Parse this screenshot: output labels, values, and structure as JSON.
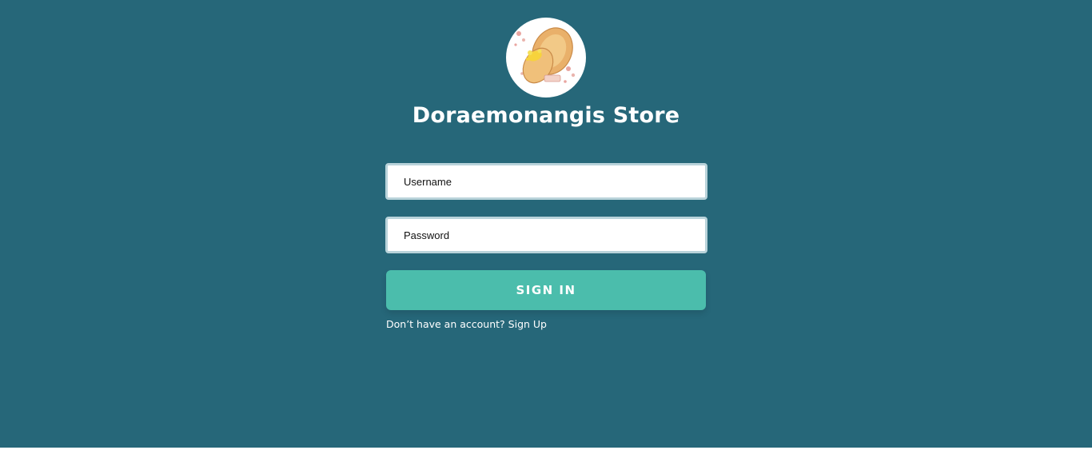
{
  "store": {
    "title": "Doraemonangis Store",
    "logo_icon": "dorayaki-logo-icon"
  },
  "form": {
    "username_placeholder": "Username",
    "password_placeholder": "Password",
    "signin_label": "SIGN IN",
    "signup_prompt": "Don’t have an account? ",
    "signup_link": "Sign Up"
  },
  "colors": {
    "background": "#266779",
    "button": "#4bbdac",
    "input_border": "#b9d3da",
    "text": "#ffffff"
  }
}
